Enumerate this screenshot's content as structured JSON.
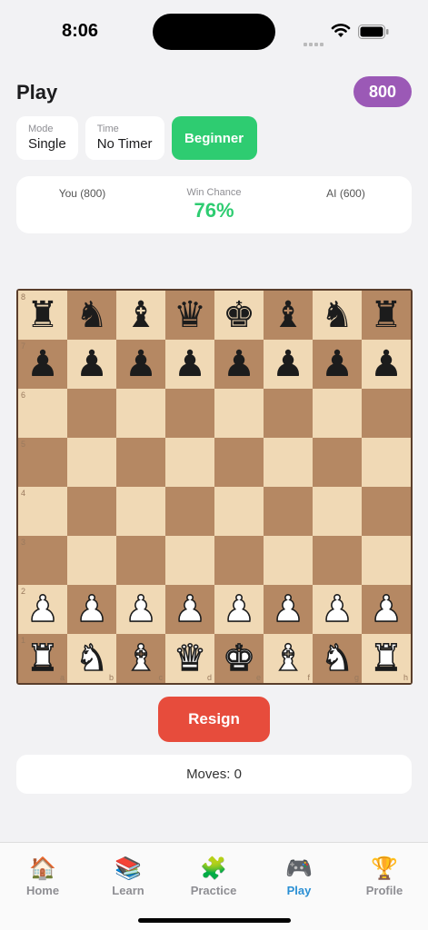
{
  "status_bar": {
    "time": "8:06"
  },
  "header": {
    "title": "Play",
    "rating": "800"
  },
  "controls": {
    "mode_label": "Mode",
    "mode_value": "Single",
    "time_label": "Time",
    "time_value": "No Timer",
    "level": "Beginner"
  },
  "scoreboard": {
    "you": "You (800)",
    "win_chance_label": "Win Chance",
    "win_chance_value": "76%",
    "ai": "AI (600)"
  },
  "board": {
    "light_color": "#f0d9b5",
    "dark_color": "#b58863",
    "ranks": [
      [
        "r",
        "n",
        "b",
        "q",
        "k",
        "b",
        "n",
        "r"
      ],
      [
        "p",
        "p",
        "p",
        "p",
        "p",
        "p",
        "p",
        "p"
      ],
      [
        "",
        "",
        "",
        "",
        "",
        "",
        "",
        ""
      ],
      [
        "",
        "",
        "",
        "",
        "",
        "",
        "",
        ""
      ],
      [
        "",
        "",
        "",
        "",
        "",
        "",
        "",
        ""
      ],
      [
        "",
        "",
        "",
        "",
        "",
        "",
        "",
        ""
      ],
      [
        "P",
        "P",
        "P",
        "P",
        "P",
        "P",
        "P",
        "P"
      ],
      [
        "R",
        "N",
        "B",
        "Q",
        "K",
        "B",
        "N",
        "R"
      ]
    ],
    "rank_labels": [
      "8",
      "7",
      "6",
      "5",
      "4",
      "3",
      "2",
      "1"
    ],
    "file_labels": [
      "a",
      "b",
      "c",
      "d",
      "e",
      "f",
      "g",
      "h"
    ]
  },
  "actions": {
    "resign": "Resign"
  },
  "moves": {
    "text": "Moves: 0"
  },
  "tabs": [
    {
      "label": "Home",
      "icon": "house-icon"
    },
    {
      "label": "Learn",
      "icon": "books-icon"
    },
    {
      "label": "Practice",
      "icon": "puzzle-icon"
    },
    {
      "label": "Play",
      "icon": "gamepad-icon",
      "active": true
    },
    {
      "label": "Profile",
      "icon": "trophy-icon"
    }
  ],
  "colors": {
    "accent_green": "#2ecc71",
    "badge_purple": "#9b59b6",
    "resign_red": "#e74c3c",
    "active_tab": "#2a8fd4"
  }
}
